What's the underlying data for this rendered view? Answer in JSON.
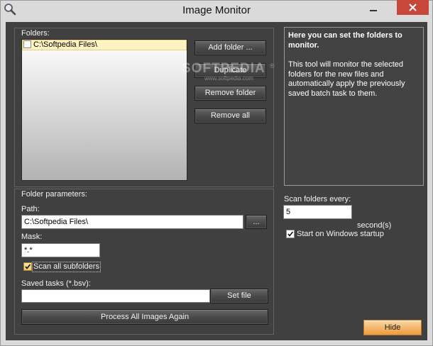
{
  "titlebar": {
    "title": "Image Monitor",
    "app_icon": "magnifier-icon",
    "minimize_icon": "minimize-icon",
    "close_icon": "close-icon"
  },
  "folders": {
    "label": "Folders:",
    "items": [
      {
        "path": "C:\\Softpedia Files\\",
        "checked": false,
        "selected": true
      }
    ],
    "buttons": {
      "add": "Add folder ...",
      "duplicate": "Duplicate",
      "remove": "Remove folder",
      "remove_all": "Remove all"
    }
  },
  "info": {
    "heading": "Here you can set the folders to monitor.",
    "body": "This tool will monitor the selected folders for the new files and automatically apply the previously saved batch task to them."
  },
  "scan": {
    "label": "Scan folders every:",
    "interval": "5",
    "unit": "second(s)",
    "startup_label": "Start on Windows startup",
    "startup_checked": true
  },
  "params": {
    "label": "Folder parameters:",
    "path_label": "Path:",
    "path_value": "C:\\Softpedia Files\\",
    "browse_label": "...",
    "mask_label": "Mask:",
    "mask_value": "*.*",
    "subfolders_label": "Scan all subfolders",
    "subfolders_checked": true,
    "saved_tasks_label": "Saved tasks (*.bsv):",
    "saved_tasks_value": "",
    "set_file_label": "Set file",
    "process_label": "Process All Images Again"
  },
  "hide_label": "Hide",
  "watermark": {
    "brand": "SOFTPEDIA",
    "registered": "®",
    "url": "www.softpedia.com"
  },
  "colors": {
    "frame": "#dadada",
    "client_bg": "#404040",
    "close_button": "#c7473a",
    "selected_item": "#fff3c2",
    "hide_button_top": "#fcd7a4",
    "hide_button_bottom": "#ec9a3c"
  }
}
